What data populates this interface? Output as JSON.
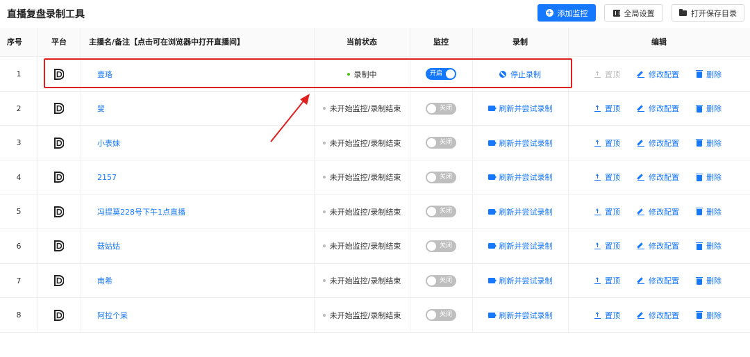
{
  "app": {
    "title": "直播复盘录制工具"
  },
  "toolbar": {
    "add_label": "添加监控",
    "global_label": "全局设置",
    "open_dir_label": "打开保存目录"
  },
  "table": {
    "headers": {
      "index": "序号",
      "platform": "平台",
      "name": "主播名/备注【点击可在浏览器中打开直播间】",
      "status": "当前状态",
      "monitor": "监控",
      "record": "录制",
      "edit": "编辑"
    },
    "rows": [
      {
        "index": "1",
        "name": "壹珞",
        "status": "录制中",
        "status_active": true,
        "monitor_on": true,
        "switch_label": "开启",
        "record_label": "停止录制",
        "top_label": "置顶",
        "top_disabled": true,
        "edit_label": "修改配置",
        "delete_label": "删除"
      },
      {
        "index": "2",
        "name": "叟",
        "status": "未开始监控/录制结束",
        "status_active": false,
        "monitor_on": false,
        "switch_label": "关闭",
        "record_label": "刷新并尝试录制",
        "top_label": "置顶",
        "top_disabled": false,
        "edit_label": "修改配置",
        "delete_label": "删除"
      },
      {
        "index": "3",
        "name": "小表妹",
        "status": "未开始监控/录制结束",
        "status_active": false,
        "monitor_on": false,
        "switch_label": "关闭",
        "record_label": "刷新并尝试录制",
        "top_label": "置顶",
        "top_disabled": false,
        "edit_label": "修改配置",
        "delete_label": "删除"
      },
      {
        "index": "4",
        "name": "2157",
        "status": "未开始监控/录制结束",
        "status_active": false,
        "monitor_on": false,
        "switch_label": "关闭",
        "record_label": "刷新并尝试录制",
        "top_label": "置顶",
        "top_disabled": false,
        "edit_label": "修改配置",
        "delete_label": "删除"
      },
      {
        "index": "5",
        "name": "冯提莫228号下午1点直播",
        "status": "未开始监控/录制结束",
        "status_active": false,
        "monitor_on": false,
        "switch_label": "关闭",
        "record_label": "刷新并尝试录制",
        "top_label": "置顶",
        "top_disabled": false,
        "edit_label": "修改配置",
        "delete_label": "删除"
      },
      {
        "index": "6",
        "name": "菇姑姑",
        "status": "未开始监控/录制结束",
        "status_active": false,
        "monitor_on": false,
        "switch_label": "关闭",
        "record_label": "刷新并尝试录制",
        "top_label": "置顶",
        "top_disabled": false,
        "edit_label": "修改配置",
        "delete_label": "删除"
      },
      {
        "index": "7",
        "name": "南希",
        "status": "未开始监控/录制结束",
        "status_active": false,
        "monitor_on": false,
        "switch_label": "关闭",
        "record_label": "刷新并尝试录制",
        "top_label": "置顶",
        "top_disabled": false,
        "edit_label": "修改配置",
        "delete_label": "删除"
      },
      {
        "index": "8",
        "name": "阿拉个呆",
        "status": "未开始监控/录制结束",
        "status_active": false,
        "monitor_on": false,
        "switch_label": "关闭",
        "record_label": "刷新并尝试录制",
        "top_label": "置顶",
        "top_disabled": false,
        "edit_label": "修改配置",
        "delete_label": "删除"
      }
    ]
  },
  "colors": {
    "primary": "#1677ff",
    "highlight": "#e02020",
    "active_dot": "#52c41a"
  },
  "icons": {
    "add": "plus-circle-icon",
    "global": "settings-icon",
    "open": "folder-open-icon",
    "platform": "douyu-platform-icon",
    "stop": "ban-icon",
    "record": "video-camera-icon",
    "top": "pin-top-icon",
    "edit": "edit-icon",
    "delete": "trash-icon"
  }
}
